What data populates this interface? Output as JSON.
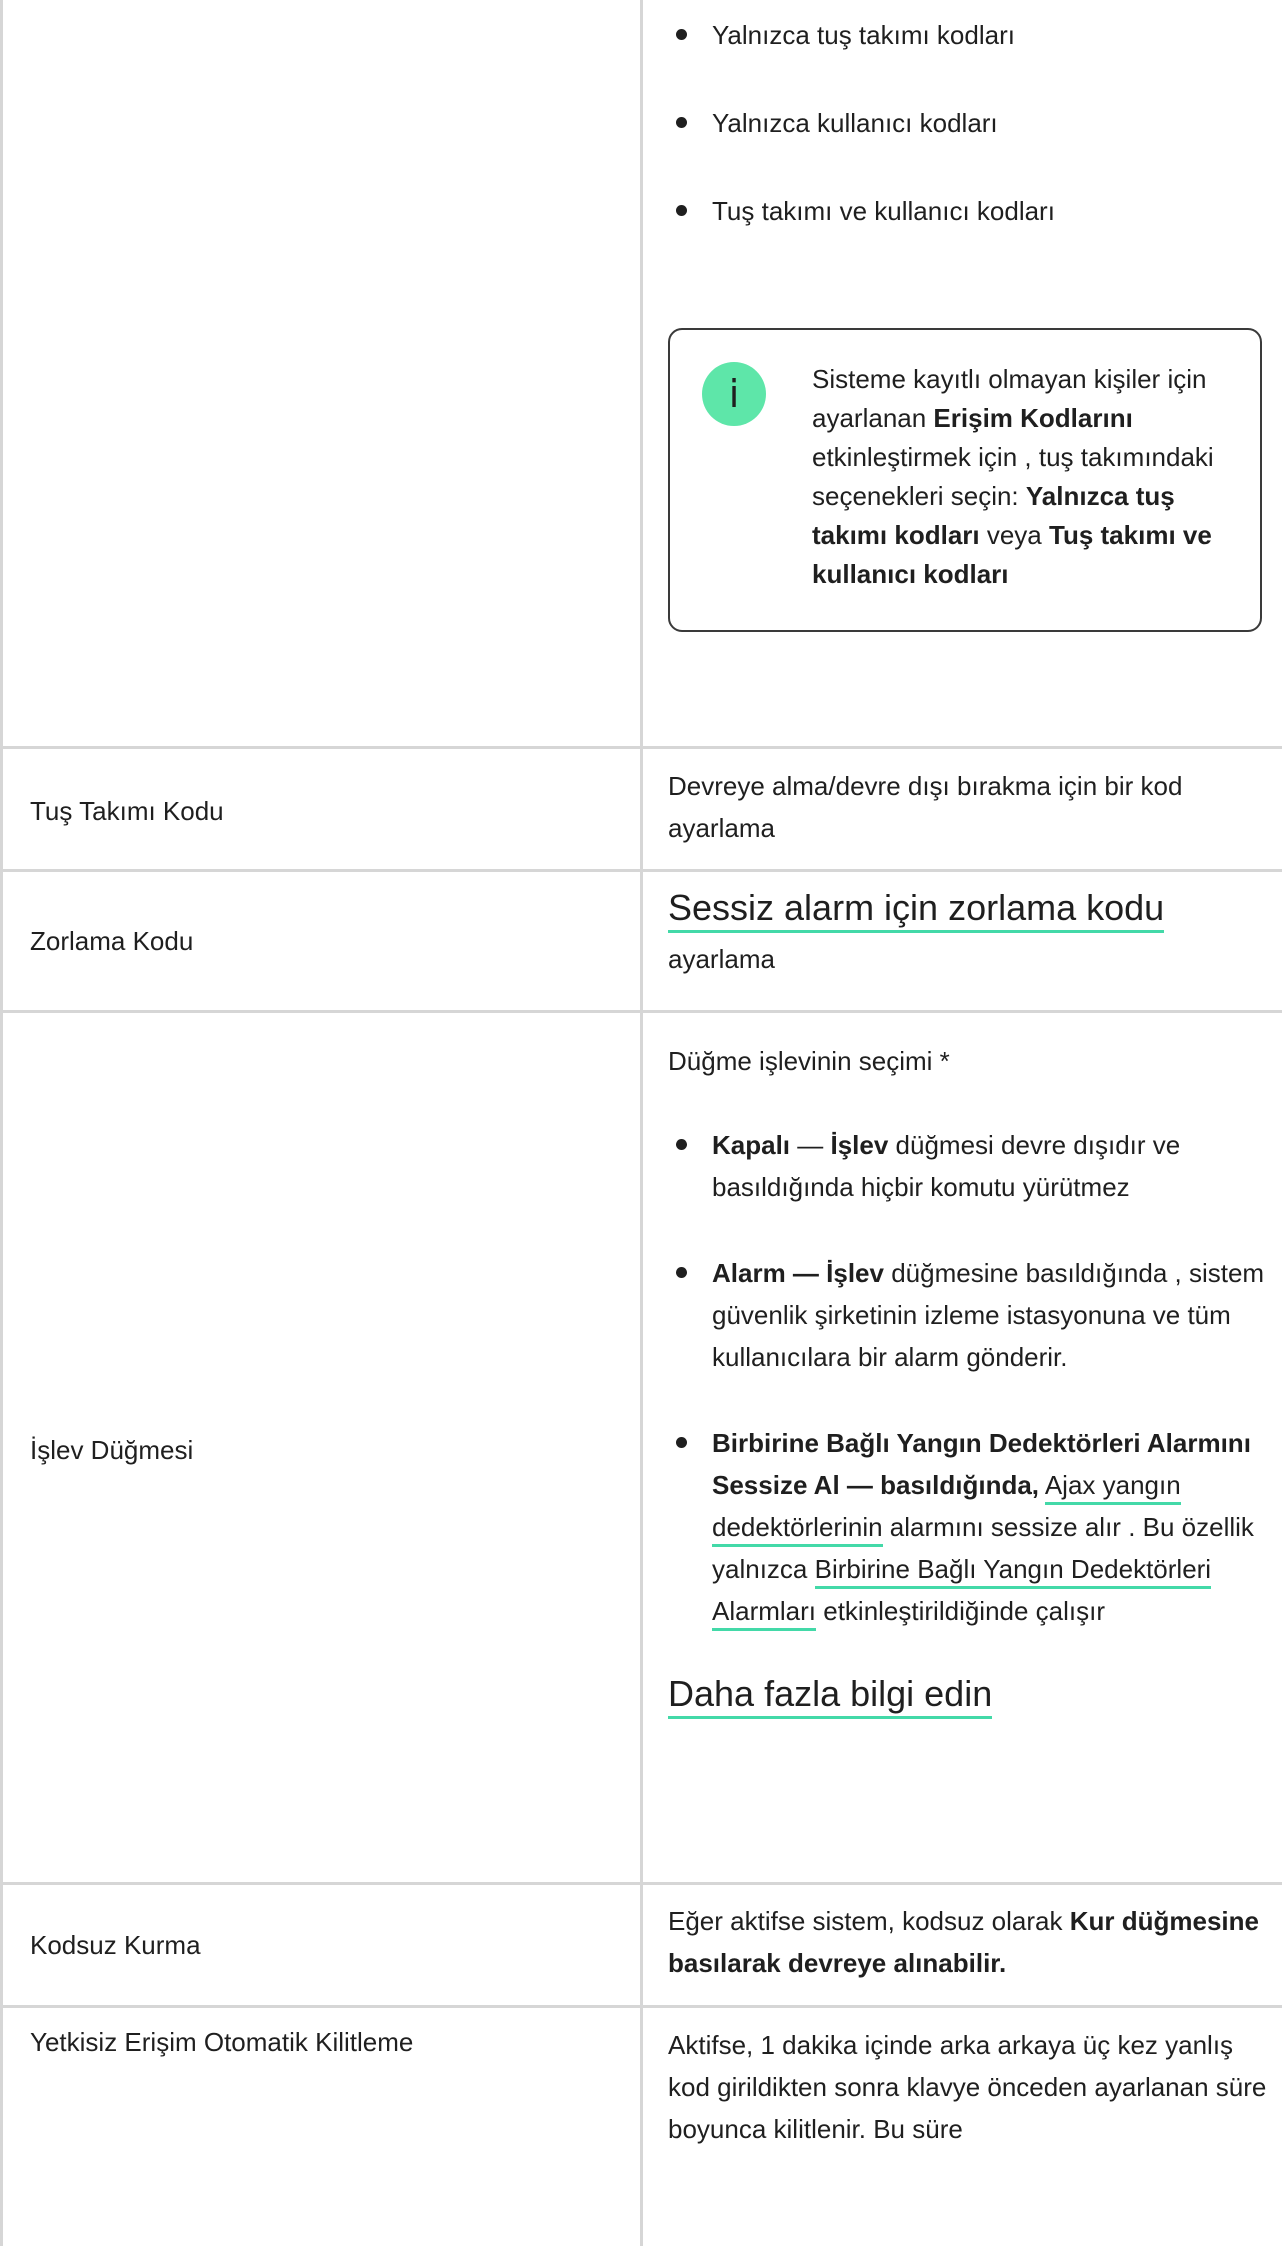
{
  "top_row": {
    "options": [
      "Yalnızca tuş takımı kodları",
      "Yalnızca kullanıcı kodları",
      "Tuş takımı ve kullanıcı kodları"
    ],
    "note": {
      "icon": "info-icon",
      "icon_glyph": "i",
      "text_1": "Sisteme kayıtlı olmayan kişiler için ayarlanan ",
      "bold_1": "Erişim Kodlarını",
      "text_2": " etkinleştirmek için , tuş takımındaki seçenekleri seçin: ",
      "bold_2": "Yalnızca tuş takımı kodları",
      "text_3": " veya ",
      "bold_3": "Tuş takımı ve kullanıcı kodları"
    }
  },
  "rows": {
    "keypad_code": {
      "label": "Tuş Takımı Kodu",
      "description": "Devreye alma/devre dışı bırakma için bir kod ayarlama"
    },
    "duress_code": {
      "label": "Zorlama Kodu",
      "link": "Sessiz alarm için zorlama kodu",
      "suffix": "ayarlama"
    },
    "function_button": {
      "label": "İşlev Düğmesi",
      "intro": "Düğme işlevinin seçimi *",
      "off_bold": "Kapalı",
      "off_dash": " — ",
      "off_bold2": "İşlev",
      "off_text": " düğmesi devre dışıdır ve basıldığında hiçbir komutu yürütmez",
      "alarm_bold": "Alarm — İşlev",
      "alarm_text": " düğmesine basıldığında , sistem güvenlik şirketinin izleme istasyonuna ve tüm kullanıcılara bir alarm gönderir.",
      "mute_bold": "Birbirine Bağlı Yangın Dedektörleri Alarmını Sessize Al — basıldığında,",
      "mute_link_1": "Ajax yangın dedektörlerinin",
      "mute_text_1": " alarmını sessize alır . Bu özellik yalnızca ",
      "mute_link_2": "Birbirine Bağlı Yangın Dedektörleri Alarmları",
      "mute_text_2": " etkinleştirildiğinde çalışır",
      "learn_more": "Daha fazla bilgi edin"
    },
    "arm_without_code": {
      "label": "Kodsuz Kurma",
      "text": "Eğer aktifse sistem, kodsuz olarak ",
      "bold": "Kur düğmesine basılarak devreye alınabilir."
    },
    "auto_lock": {
      "label_1": "Yetkisiz",
      "label_2": " Erişim Otomatik Kilitleme",
      "text": "Aktifse, 1 dakika içinde arka arkaya üç kez yanlış kod girildikten sonra klavye önceden ayarlanan süre boyunca kilitlenir. Bu süre"
    }
  },
  "colors": {
    "link_underline": "#43d9a8",
    "info_icon_bg": "#5ee6a9",
    "grid_line": "#d6d6d6"
  }
}
